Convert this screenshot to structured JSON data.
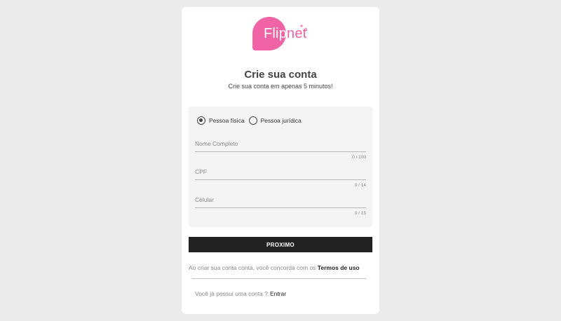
{
  "logo": {
    "part1": "Flip",
    "part2": "net",
    "brand_color": "#f063a4"
  },
  "header": {
    "title": "Crie sua conta",
    "subtitle": "Crie sua conta em apenas 5 minutos!"
  },
  "person_type": {
    "options": [
      {
        "label": "Pessoa física",
        "selected": true
      },
      {
        "label": "Pessoa jurídica",
        "selected": false
      }
    ]
  },
  "fields": [
    {
      "placeholder": "Nome Completo",
      "counter": "0 / 100"
    },
    {
      "placeholder": "CPF",
      "counter": "0 / 14"
    },
    {
      "placeholder": "Celular",
      "counter": "0 / 15"
    }
  ],
  "next_button": {
    "label": "PROXIMO"
  },
  "terms": {
    "text": "Ao criar sua conta conta, você concorda com os ",
    "link": "Termos de uso"
  },
  "login": {
    "text": "Você já possui uma conta ?",
    "link": "Entrar"
  }
}
